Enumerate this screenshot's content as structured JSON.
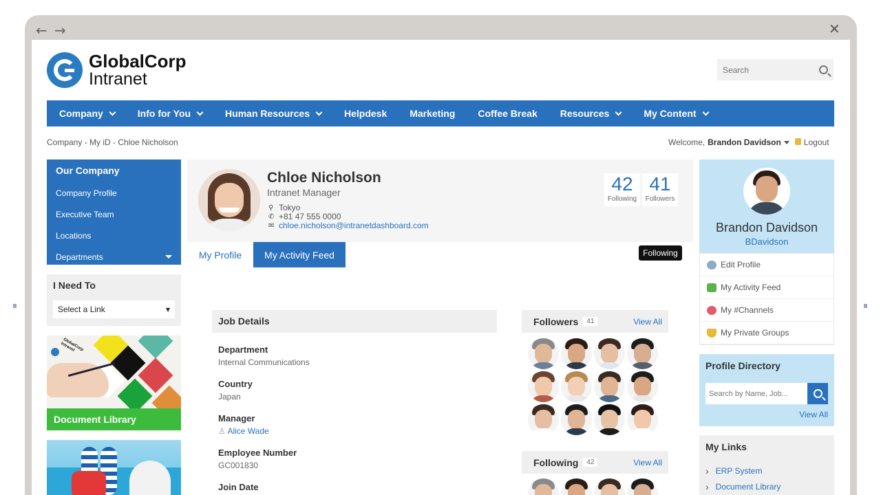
{
  "browser": {
    "back_glyph": "←",
    "forward_glyph": "→",
    "close_glyph": "✕"
  },
  "brand": {
    "name_line1": "GlobalCorp",
    "name_line2": "Intranet",
    "accent": "#2a71bd"
  },
  "search": {
    "placeholder": "Search"
  },
  "menu": [
    {
      "label": "Company",
      "dropdown": true
    },
    {
      "label": "Info for You",
      "dropdown": true
    },
    {
      "label": "Human Resources",
      "dropdown": true
    },
    {
      "label": "Helpdesk",
      "dropdown": false
    },
    {
      "label": "Marketing",
      "dropdown": false
    },
    {
      "label": "Coffee Break",
      "dropdown": false
    },
    {
      "label": "Resources",
      "dropdown": true
    },
    {
      "label": "My Content",
      "dropdown": true
    }
  ],
  "breadcrumb": "Company - My iD - Chloe Nicholson",
  "welcome": {
    "prefix": "Welcome,",
    "user": "Brandon Davidson",
    "logout": "Logout"
  },
  "left_nav": {
    "title": "Our Company",
    "items": [
      "Company Profile",
      "Executive Team",
      "Locations",
      "Departments"
    ]
  },
  "i_need_to": {
    "title": "I Need To",
    "select_value": "Select a Link",
    "select_arrow": "▾"
  },
  "doc_library": {
    "label": "Document Library",
    "art_text_1": "GlobalCorp",
    "art_text_2": "Intranet"
  },
  "profile": {
    "name": "Chloe Nicholson",
    "role": "Intranet Manager",
    "location": "Tokyo",
    "phone": "+81 47 555 0000",
    "email": "chloe.nicholson@intranetdashboard.com",
    "following_count": "42",
    "following_label": "Following",
    "followers_count": "41",
    "followers_label": "Followers"
  },
  "tabs": {
    "profile": "My Profile",
    "activity": "My Activity Feed"
  },
  "follow_button": "Following",
  "job": {
    "title": "Job Details",
    "department_label": "Department",
    "department": "Internal Communications",
    "country_label": "Country",
    "country": "Japan",
    "manager_label": "Manager",
    "manager": "Alice Wade",
    "empno_label": "Employee Number",
    "empno": "GC001830",
    "joindate_label": "Join Date"
  },
  "followers": {
    "title": "Followers",
    "count": "41",
    "view_all": "View All"
  },
  "following": {
    "title": "Following",
    "count": "42",
    "view_all": "View All"
  },
  "me": {
    "name": "Brandon Davidson",
    "handle": "BDavidson"
  },
  "me_links": [
    "Edit Profile",
    "My Activity Feed",
    "My #Channels",
    "My Private Groups"
  ],
  "directory": {
    "title": "Profile Directory",
    "placeholder": "Search by Name, Job...",
    "view_all": "View All"
  },
  "my_links": {
    "title": "My Links",
    "items": [
      "ERP System",
      "Document Library"
    ]
  }
}
